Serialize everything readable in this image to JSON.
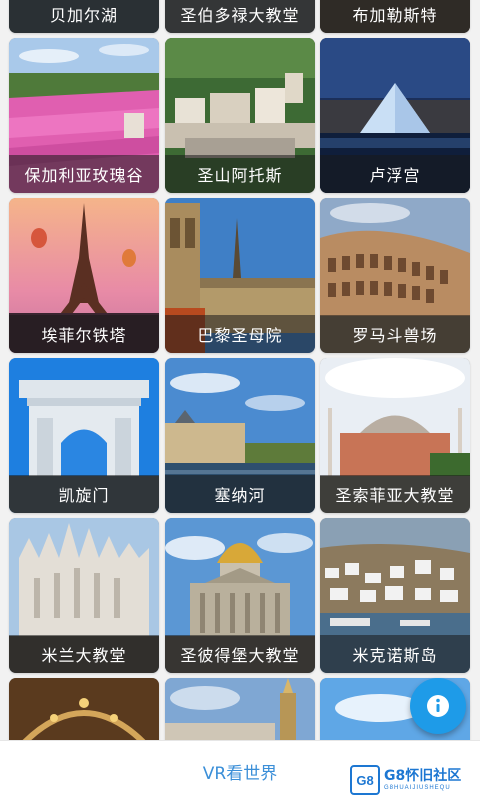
{
  "landmarks": [
    {
      "label": "贝加尔湖"
    },
    {
      "label": "圣伯多禄大教堂"
    },
    {
      "label": "布加勒斯特"
    },
    {
      "label": "保加利亚玫瑰谷"
    },
    {
      "label": "圣山阿托斯"
    },
    {
      "label": "卢浮宫"
    },
    {
      "label": "埃菲尔铁塔"
    },
    {
      "label": "巴黎圣母院"
    },
    {
      "label": "罗马斗兽场"
    },
    {
      "label": "凯旋门"
    },
    {
      "label": "塞纳河"
    },
    {
      "label": "圣索菲亚大教堂"
    },
    {
      "label": "米兰大教堂"
    },
    {
      "label": "圣彼得堡大教堂"
    },
    {
      "label": "米克诺斯岛"
    },
    {
      "label": ""
    },
    {
      "label": ""
    },
    {
      "label": ""
    }
  ],
  "bottom_bar": {
    "title": "VR看世界"
  },
  "watermark": {
    "badge": "G8",
    "main": "G8怀旧社区",
    "sub": "G8HUAIJIUSHEQU"
  },
  "fab": {
    "icon": "info-icon"
  },
  "colors": {
    "accent": "#3b8fd8",
    "fab": "#1e9be8",
    "watermark": "#1d77d2"
  }
}
